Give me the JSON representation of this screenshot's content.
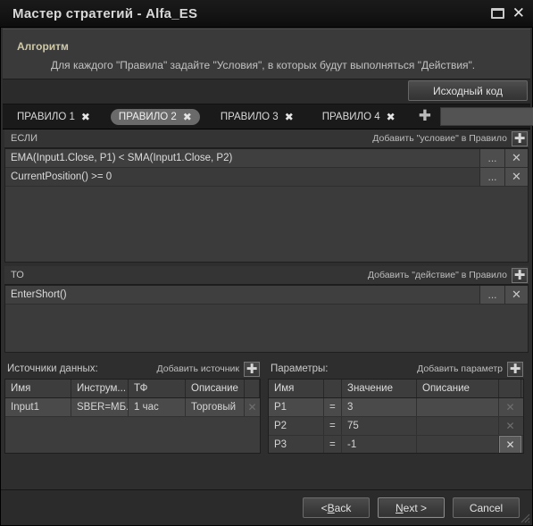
{
  "window": {
    "title": "Мастер стратегий - Alfa_ES",
    "minimize_icon": "restore-icon",
    "close_icon": "close-icon"
  },
  "header": {
    "algorithm_title": "Алгоритм",
    "algorithm_description": "Для каждого \"Правила\" задайте \"Условия\", в которых будут выполняться \"Действия\".",
    "source_code_button": "Исходный код"
  },
  "tabs": {
    "items": [
      {
        "label": "ПРАВИЛО 1",
        "close": "✖",
        "active": false
      },
      {
        "label": "ПРАВИЛО 2",
        "close": "✖",
        "active": true
      },
      {
        "label": "ПРАВИЛО 3",
        "close": "✖",
        "active": false
      },
      {
        "label": "ПРАВИЛО 4",
        "close": "✖",
        "active": false
      }
    ],
    "add_label": "✚",
    "name_input_value": "",
    "name_input_placeholder": ""
  },
  "if_panel": {
    "label": "ЕСЛИ",
    "action_label": "Добавить \"условие\" в Правило",
    "add_icon": "✚",
    "rows": [
      {
        "text": "EMA(Input1.Close, P1) < SMA(Input1.Close, P2)",
        "dots": "...",
        "close": "✕"
      },
      {
        "text": "CurrentPosition() >= 0",
        "dots": "...",
        "close": "✕"
      }
    ]
  },
  "then_panel": {
    "label": "ТО",
    "action_label": "Добавить \"действие\" в Правило",
    "add_icon": "✚",
    "rows": [
      {
        "text": "EnterShort()",
        "dots": "...",
        "close": "✕"
      }
    ]
  },
  "data_sources": {
    "caption": "Источники данных:",
    "action_label": "Добавить источник",
    "add_icon": "✚",
    "columns": [
      "Имя",
      "Инструм...",
      "ТФ",
      "Описание",
      ""
    ],
    "rows": [
      {
        "name": "Input1",
        "instrument": "SBER=МБ...",
        "tf": "1 час",
        "description": "Торговый",
        "close": "✕"
      }
    ]
  },
  "parameters": {
    "caption": "Параметры:",
    "action_label": "Добавить параметр",
    "add_icon": "✚",
    "columns": [
      "Имя",
      "",
      "Значение",
      "Описание",
      ""
    ],
    "rows": [
      {
        "name": "P1",
        "eq": "=",
        "value": "3",
        "description": "",
        "close": "✕",
        "selected": true,
        "close_active": false
      },
      {
        "name": "P2",
        "eq": "=",
        "value": "75",
        "description": "",
        "close": "✕",
        "selected": false,
        "close_active": false
      },
      {
        "name": "P3",
        "eq": "=",
        "value": "-1",
        "description": "",
        "close": "✕",
        "selected": false,
        "close_active": true
      }
    ]
  },
  "footer": {
    "back_pre": "< ",
    "back_accel": "B",
    "back_post": "ack",
    "next_pre": "",
    "next_accel": "N",
    "next_post": "ext >",
    "cancel": "Cancel"
  },
  "colors": {
    "window_bg": "#2e2e2e",
    "titlebar_bg": "#121212",
    "panel_bg": "#3b3b3b",
    "accent_text": "#cfc9a8",
    "tab_active_bg": "#6a6a6a"
  }
}
